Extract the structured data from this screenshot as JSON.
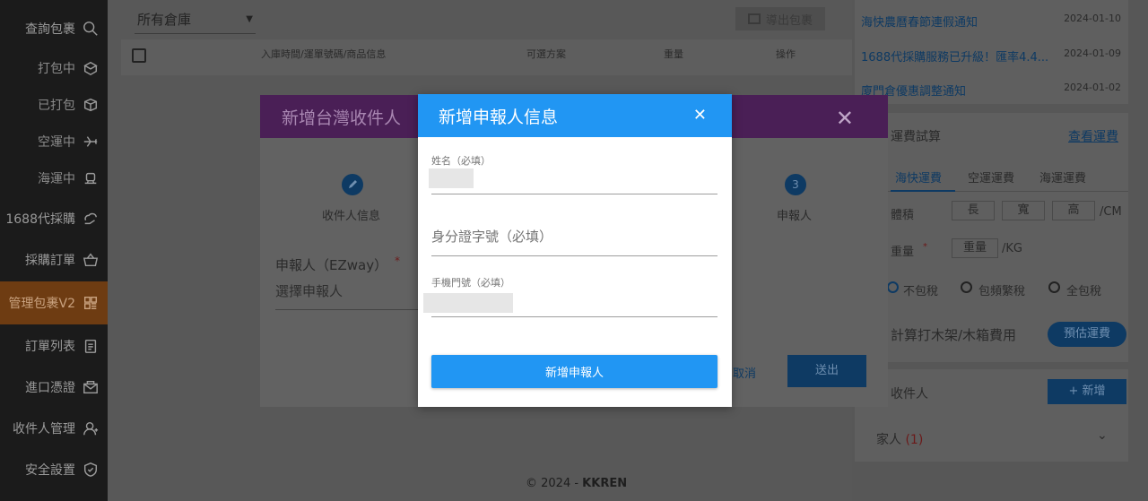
{
  "sidebar": {
    "items": [
      {
        "label": "查詢包裹",
        "icon": "search-icon"
      },
      {
        "label": "打包中",
        "icon": "package-open-icon"
      },
      {
        "label": "已打包",
        "icon": "box-icon"
      },
      {
        "label": "空運中",
        "icon": "airplane-icon"
      },
      {
        "label": "海運中",
        "icon": "ship-icon"
      },
      {
        "label": "1688代採購",
        "icon": "cloud-hand-icon"
      },
      {
        "label": "採購訂單",
        "icon": "basket-icon"
      },
      {
        "label": "管理包裹V2",
        "icon": "grid-icon"
      },
      {
        "label": "訂單列表",
        "icon": "clipboard-icon"
      },
      {
        "label": "進口憑證",
        "icon": "mail-icon"
      },
      {
        "label": "收件人管理",
        "icon": "user-icon"
      },
      {
        "label": "安全設置",
        "icon": "shield-icon"
      }
    ]
  },
  "main": {
    "warehouse_select": "所有倉庫",
    "export_button": "導出包裹",
    "table_headers": [
      "入庫時間/運單號碼/商品信息",
      "可選方案",
      "重量",
      "操作"
    ],
    "footer_prefix": "© 2024 - ",
    "footer_brand": "KKREN"
  },
  "right": {
    "notices": [
      {
        "title": "海快農曆春節連假通知",
        "date": "2024-01-10"
      },
      {
        "title": "1688代採購服務已升級！匯率4.4...",
        "date": "2024-01-09"
      },
      {
        "title": "廈門倉優惠調整通知",
        "date": "2024-01-02"
      }
    ],
    "calc": {
      "title": "運費試算",
      "link": "查看運費",
      "tabs": [
        "海快運費",
        "空運運費",
        "海運運費"
      ],
      "volume_label": "體積",
      "dims": [
        "長",
        "寬",
        "高"
      ],
      "dim_unit": "/CM",
      "weight_label": "重量",
      "weight_ph": "重量",
      "weight_unit": "/KG",
      "tax_options": [
        "不包稅",
        "包頻繁稅",
        "全包稅"
      ],
      "wood_label": "計算打木架/木箱費用",
      "estimate_button": "預估運費"
    },
    "recipients": {
      "title": "收件人",
      "add_button": "新增",
      "group": "家人",
      "count": "(1)"
    }
  },
  "bg_modal": {
    "title": "新增台灣收件人",
    "step1": "收件人信息",
    "step3_num": "3",
    "step3": "申報人",
    "declarer_label": "申報人（EZway）",
    "declarer_placeholder": "選擇申報人",
    "cancel": "取消",
    "submit": "送出"
  },
  "modal": {
    "title": "新增申報人信息",
    "name_label": "姓名（必填）",
    "id_placeholder": "身分證字號（必填）",
    "phone_label": "手機門號（必填）",
    "submit": "新增申報人"
  },
  "colors": {
    "primary": "#2196f3",
    "purple": "#7b2c8e",
    "active_sidebar": "#d4731f"
  }
}
